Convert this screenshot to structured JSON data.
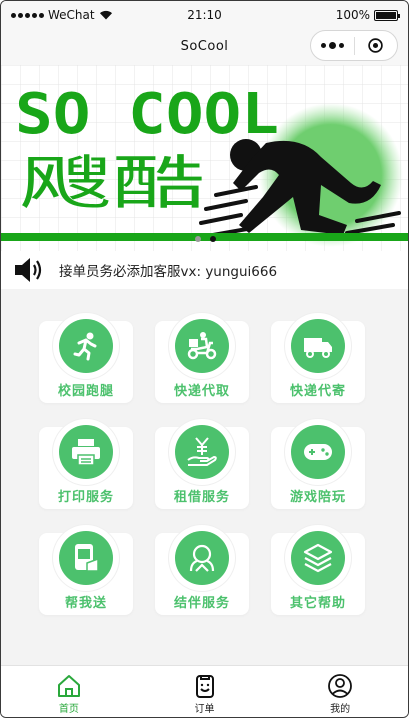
{
  "status_bar": {
    "carrier": "WeChat",
    "time": "21:10",
    "battery": "100%"
  },
  "nav": {
    "title": "SoCool"
  },
  "banner": {
    "line1": "SO COOL",
    "line2": "飕酷",
    "active_dot": 1,
    "dot_count": 2
  },
  "notice": {
    "icon": "speaker-icon",
    "text": "接单员务必添加客服vx: yungui666"
  },
  "services": [
    {
      "label": "校园跑腿",
      "icon": "runner-icon"
    },
    {
      "label": "快递代取",
      "icon": "delivery-scooter-icon"
    },
    {
      "label": "快递代寄",
      "icon": "truck-icon"
    },
    {
      "label": "打印服务",
      "icon": "printer-icon"
    },
    {
      "label": "租借服务",
      "icon": "yen-hand-icon"
    },
    {
      "label": "游戏陪玩",
      "icon": "gamepad-icon"
    },
    {
      "label": "帮我送",
      "icon": "phone-delivery-icon"
    },
    {
      "label": "结伴服务",
      "icon": "companion-icon"
    },
    {
      "label": "其它帮助",
      "icon": "layers-icon"
    }
  ],
  "tabbar": {
    "items": [
      {
        "label": "首页",
        "icon": "home-icon",
        "active": true
      },
      {
        "label": "订单",
        "icon": "order-icon",
        "active": false
      },
      {
        "label": "我的",
        "icon": "profile-icon",
        "active": false
      }
    ]
  },
  "colors": {
    "accent": "#4cc16d",
    "banner_green": "#19a619",
    "active_tab": "#2aa83c"
  }
}
